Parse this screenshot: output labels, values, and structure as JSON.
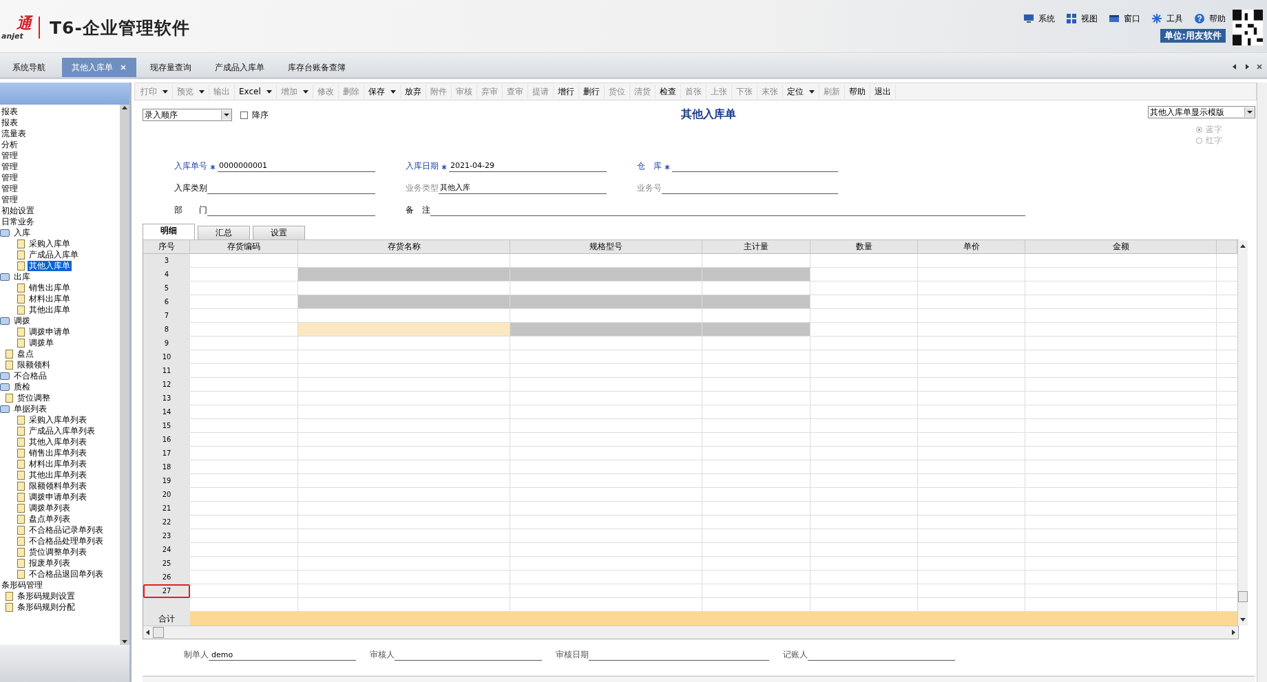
{
  "header": {
    "logo_text": "通",
    "logo_sub": "anjet",
    "product": "T6-企业管理软件",
    "menu": [
      {
        "label": "系统"
      },
      {
        "label": "视图"
      },
      {
        "label": "窗口"
      },
      {
        "label": "工具"
      },
      {
        "label": "帮助"
      }
    ],
    "unit": "单位:用友软件"
  },
  "tabs": [
    {
      "label": "系统导航",
      "selected": false,
      "closable": false
    },
    {
      "label": "其他入库单",
      "selected": true,
      "closable": true
    },
    {
      "label": "现存量查询",
      "selected": false,
      "closable": false
    },
    {
      "label": "产成品入库单",
      "selected": false,
      "closable": false
    },
    {
      "label": "库存台账备查簿",
      "selected": false,
      "closable": false
    }
  ],
  "sidebar": {
    "items": [
      {
        "label": "报表"
      },
      {
        "label": "报表"
      },
      {
        "label": "流量表"
      },
      {
        "label": "分析"
      },
      {
        "label": "管理"
      },
      {
        "label": "管理"
      },
      {
        "label": "管理"
      },
      {
        "label": "管理"
      },
      {
        "label": "管理"
      },
      {
        "label": "初始设置"
      },
      {
        "label": "日常业务",
        "children": [
          {
            "label": "入库",
            "kind": "folder",
            "selected": false,
            "children": [
              {
                "label": "采购入库单",
                "kind": "doc",
                "selected": false
              },
              {
                "label": "产成品入库单",
                "kind": "doc",
                "selected": false
              },
              {
                "label": "其他入库单",
                "kind": "doc",
                "selected": true
              }
            ]
          },
          {
            "label": "出库",
            "kind": "folder",
            "selected": false,
            "children": [
              {
                "label": "销售出库单",
                "kind": "doc",
                "selected": false
              },
              {
                "label": "材料出库单",
                "kind": "doc",
                "selected": false
              },
              {
                "label": "其他出库单",
                "kind": "doc",
                "selected": false
              }
            ]
          },
          {
            "label": "调拨",
            "kind": "folder",
            "selected": false,
            "children": [
              {
                "label": "调拨申请单",
                "kind": "doc",
                "selected": false
              },
              {
                "label": "调拨单",
                "kind": "doc",
                "selected": false
              }
            ]
          },
          {
            "label": "盘点",
            "kind": "doc",
            "selected": false
          },
          {
            "label": "限额领料",
            "kind": "doc",
            "selected": false
          },
          {
            "label": "不合格品",
            "kind": "folder",
            "selected": false
          },
          {
            "label": "质检",
            "kind": "folder",
            "selected": false
          },
          {
            "label": "货位调整",
            "kind": "doc",
            "selected": false
          },
          {
            "label": "单据列表",
            "kind": "folder",
            "selected": false,
            "children": [
              {
                "label": "采购入库单列表",
                "kind": "doc",
                "selected": false
              },
              {
                "label": "产成品入库单列表",
                "kind": "doc",
                "selected": false
              },
              {
                "label": "其他入库单列表",
                "kind": "doc",
                "selected": false
              },
              {
                "label": "销售出库单列表",
                "kind": "doc",
                "selected": false
              },
              {
                "label": "材料出库单列表",
                "kind": "doc",
                "selected": false
              },
              {
                "label": "其他出库单列表",
                "kind": "doc",
                "selected": false
              },
              {
                "label": "限额领料单列表",
                "kind": "doc",
                "selected": false
              },
              {
                "label": "调拨申请单列表",
                "kind": "doc",
                "selected": false
              },
              {
                "label": "调拨单列表",
                "kind": "doc",
                "selected": false
              },
              {
                "label": "盘点单列表",
                "kind": "doc",
                "selected": false
              },
              {
                "label": "不合格品记录单列表",
                "kind": "doc",
                "selected": false
              },
              {
                "label": "不合格品处理单列表",
                "kind": "doc",
                "selected": false
              },
              {
                "label": "货位调整单列表",
                "kind": "doc",
                "selected": false
              },
              {
                "label": "报废单列表",
                "kind": "doc",
                "selected": false
              },
              {
                "label": "不合格品退回单列表",
                "kind": "doc",
                "selected": false
              }
            ]
          }
        ]
      },
      {
        "label": "条形码管理",
        "children": [
          {
            "label": "条形码规则设置",
            "kind": "doc",
            "selected": false
          },
          {
            "label": "条形码规则分配",
            "kind": "doc",
            "selected": false
          }
        ]
      }
    ]
  },
  "toolbar": [
    {
      "label": "打印",
      "dropdown": true,
      "disabled": true
    },
    {
      "label": "预览",
      "dropdown": true,
      "disabled": true
    },
    {
      "label": "输出",
      "dropdown": false,
      "disabled": true
    },
    {
      "label": "Excel",
      "dropdown": true,
      "disabled": false
    },
    {
      "label": "增加",
      "dropdown": true,
      "disabled": true
    },
    {
      "label": "修改",
      "dropdown": false,
      "disabled": true
    },
    {
      "label": "删除",
      "dropdown": false,
      "disabled": true
    },
    {
      "label": "保存",
      "dropdown": true,
      "disabled": false
    },
    {
      "label": "放弃",
      "dropdown": false,
      "disabled": false
    },
    {
      "label": "附件",
      "dropdown": false,
      "disabled": true
    },
    {
      "label": "审核",
      "dropdown": false,
      "disabled": true
    },
    {
      "label": "弃审",
      "dropdown": false,
      "disabled": true
    },
    {
      "label": "查审",
      "dropdown": false,
      "disabled": true
    },
    {
      "label": "提请",
      "dropdown": false,
      "disabled": true
    },
    {
      "label": "增行",
      "dropdown": false,
      "disabled": false
    },
    {
      "label": "删行",
      "dropdown": false,
      "disabled": false
    },
    {
      "label": "货位",
      "dropdown": false,
      "disabled": true
    },
    {
      "label": "清货",
      "dropdown": false,
      "disabled": true
    },
    {
      "label": "检查",
      "dropdown": false,
      "disabled": false
    },
    {
      "label": "首张",
      "dropdown": false,
      "disabled": true
    },
    {
      "label": "上张",
      "dropdown": false,
      "disabled": true
    },
    {
      "label": "下张",
      "dropdown": false,
      "disabled": true
    },
    {
      "label": "末张",
      "dropdown": false,
      "disabled": true
    },
    {
      "label": "定位",
      "dropdown": true,
      "disabled": false
    },
    {
      "label": "刷新",
      "dropdown": false,
      "disabled": true
    },
    {
      "label": "帮助",
      "dropdown": false,
      "disabled": false
    },
    {
      "label": "退出",
      "dropdown": false,
      "disabled": false
    }
  ],
  "form": {
    "sort_select": "录入顺序",
    "descending": {
      "label": "降序",
      "checked": false
    },
    "title": "其他入库单",
    "template_select": "其他入库单显示模版",
    "color_options": [
      {
        "label": "蓝字",
        "selected": true,
        "disabled": true
      },
      {
        "label": "红字",
        "selected": false,
        "disabled": true
      }
    ],
    "field_rows": [
      [
        {
          "label": "入库单号",
          "value": "0000000001",
          "required": true,
          "disabled": false
        },
        {
          "label": "入库日期",
          "value": "2021-04-29",
          "required": true,
          "disabled": false
        },
        {
          "label": "仓　库",
          "required": true,
          "disabled": false
        }
      ],
      [
        {
          "label": "入库类别",
          "required": false,
          "disabled": false
        },
        {
          "label": "业务类型",
          "value": "其他入库",
          "required": false,
          "disabled": true
        },
        {
          "label": "业务号",
          "required": false,
          "disabled": true
        }
      ],
      [
        {
          "label": "部　　门",
          "required": false,
          "disabled": false
        },
        {
          "label": "备　注",
          "required": false,
          "disabled": false
        }
      ]
    ]
  },
  "detail_tabs": [
    {
      "label": "明细",
      "selected": true
    },
    {
      "label": "汇总",
      "selected": false
    },
    {
      "label": "设置",
      "selected": false
    }
  ],
  "table": {
    "columns": [
      "序号",
      "存货编码",
      "存货名称",
      "规格型号",
      "主计量",
      "数量",
      "单价",
      "金额"
    ],
    "rows": [
      {
        "no": "3",
        "disabled": false,
        "current": false,
        "highlighted": false
      },
      {
        "no": "4",
        "disabled": true,
        "current": false,
        "highlighted": false
      },
      {
        "no": "5",
        "disabled": false,
        "current": false,
        "highlighted": false
      },
      {
        "no": "6",
        "disabled": true,
        "current": false,
        "highlighted": false
      },
      {
        "no": "7",
        "disabled": false,
        "current": false,
        "highlighted": false
      },
      {
        "no": "8",
        "disabled": true,
        "current": true,
        "highlighted": false
      },
      {
        "no": "9",
        "disabled": false,
        "current": false,
        "highlighted": false
      },
      {
        "no": "10",
        "disabled": false,
        "current": false,
        "highlighted": false
      },
      {
        "no": "11",
        "disabled": false,
        "current": false,
        "highlighted": false
      },
      {
        "no": "12",
        "disabled": false,
        "current": false,
        "highlighted": false
      },
      {
        "no": "13",
        "disabled": false,
        "current": false,
        "highlighted": false
      },
      {
        "no": "14",
        "disabled": false,
        "current": false,
        "highlighted": false
      },
      {
        "no": "15",
        "disabled": false,
        "current": false,
        "highlighted": false
      },
      {
        "no": "16",
        "disabled": false,
        "current": false,
        "highlighted": false
      },
      {
        "no": "17",
        "disabled": false,
        "current": false,
        "highlighted": false
      },
      {
        "no": "18",
        "disabled": false,
        "current": false,
        "highlighted": false
      },
      {
        "no": "19",
        "disabled": false,
        "current": false,
        "highlighted": false
      },
      {
        "no": "20",
        "disabled": false,
        "current": false,
        "highlighted": false
      },
      {
        "no": "21",
        "disabled": false,
        "current": false,
        "highlighted": false
      },
      {
        "no": "22",
        "disabled": false,
        "current": false,
        "highlighted": false
      },
      {
        "no": "23",
        "disabled": false,
        "current": false,
        "highlighted": false
      },
      {
        "no": "24",
        "disabled": false,
        "current": false,
        "highlighted": false
      },
      {
        "no": "25",
        "disabled": false,
        "current": false,
        "highlighted": false
      },
      {
        "no": "26",
        "disabled": false,
        "current": false,
        "highlighted": false
      },
      {
        "no": "27",
        "disabled": false,
        "current": false,
        "highlighted": true
      },
      {
        "disabled": false,
        "current": false,
        "highlighted": false
      }
    ],
    "total_label": "合计"
  },
  "signatures": [
    {
      "label": "制单人",
      "value": "demo"
    },
    {
      "label": "审核人"
    },
    {
      "label": "审核日期"
    },
    {
      "label": "记账人"
    }
  ]
}
